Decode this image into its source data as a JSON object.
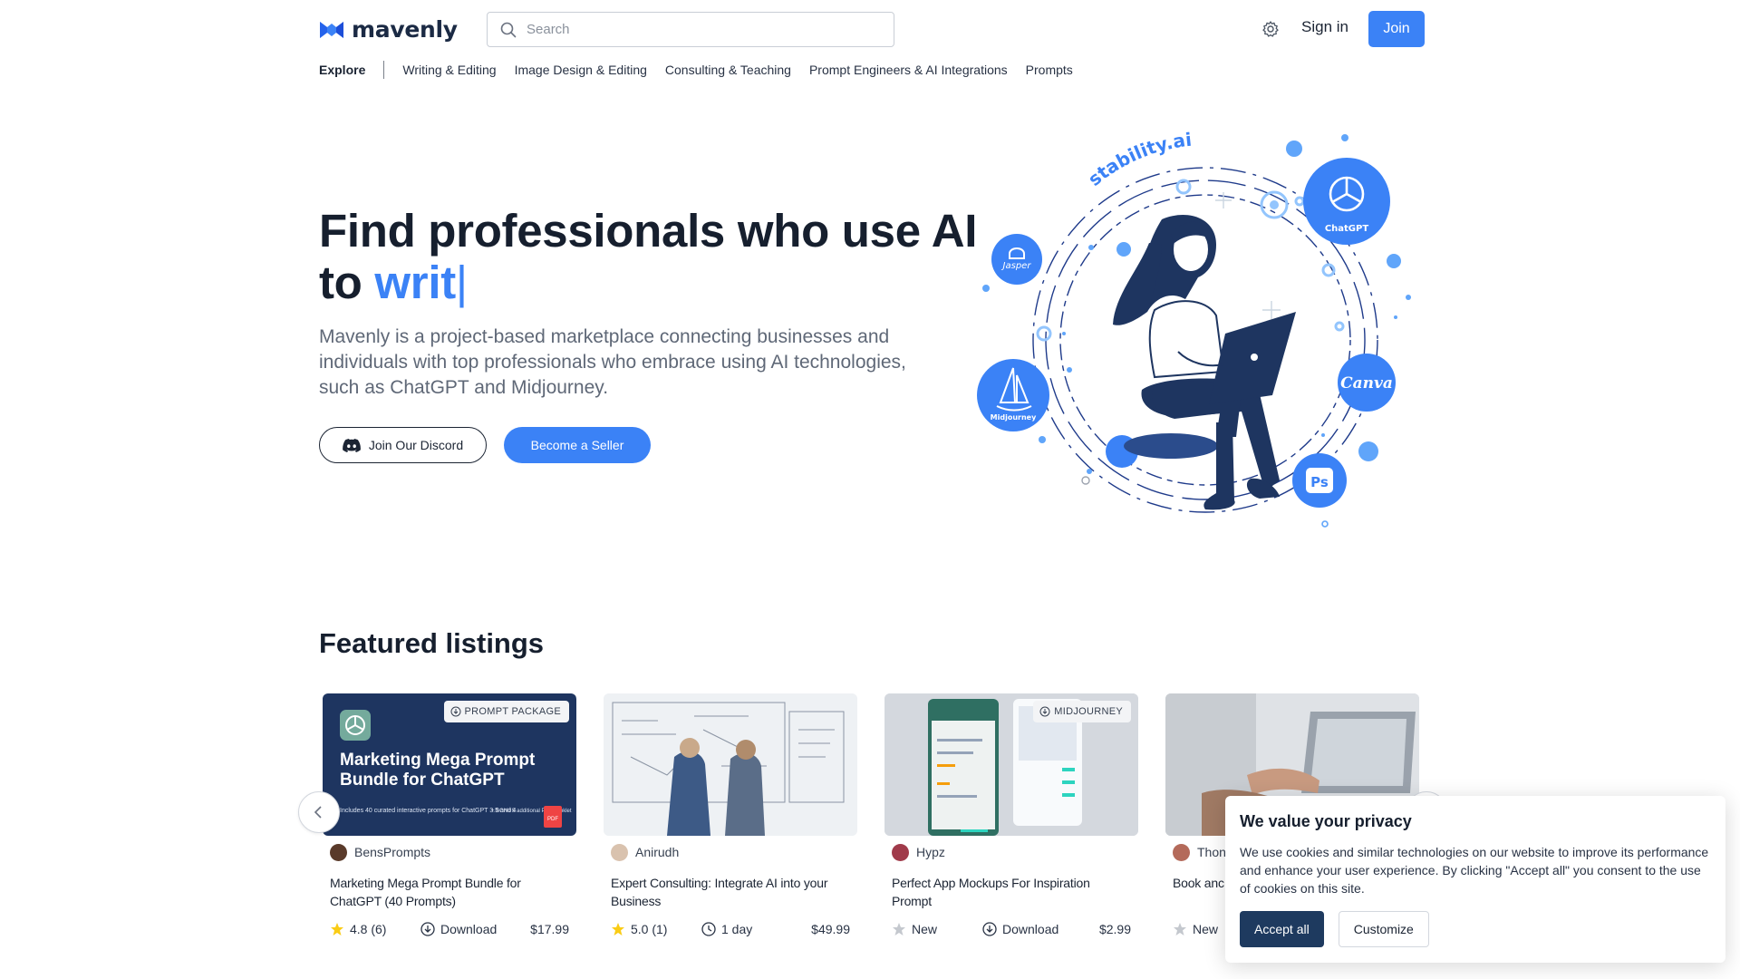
{
  "brand": {
    "name": "mavenly",
    "color": "#3b82f6",
    "dark": "#1b2a44"
  },
  "header": {
    "search_placeholder": "Search",
    "signin_label": "Sign in",
    "join_label": "Join"
  },
  "nav": {
    "explore": "Explore",
    "categories": [
      "Writing & Editing",
      "Image Design & Editing",
      "Consulting & Teaching",
      "Prompt Engineers & AI Integrations",
      "Prompts"
    ]
  },
  "hero": {
    "title_line1": "Find professionals who use AI",
    "title_prefix": "to",
    "title_typed": "writ",
    "title_caret": "|",
    "description": "Mavenly is a project-based marketplace connecting businesses and individuals with top professionals who embrace using AI technologies, such as ChatGPT and Midjourney.",
    "discord_label": "Join Our Discord",
    "seller_label": "Become a Seller",
    "art_labels": {
      "stability": "stability.ai",
      "chatgpt": "ChatGPT",
      "jasper": "Jasper",
      "canva": "Canva",
      "midjourney": "Midjourney",
      "photoshop": "Ps"
    }
  },
  "featured": {
    "title": "Featured listings",
    "cards": [
      {
        "badge": "PROMPT PACKAGE",
        "thumb_title": "Marketing Mega Prompt Bundle for ChatGPT",
        "thumb_sub": "Includes 40 curated interactive prompts for ChatGPT 3.5 and 4",
        "thumb_bonus": "+ BONUS additional PDF booklet",
        "thumb_pdf": "PDF",
        "seller": "BensPrompts",
        "title": "Marketing Mega Prompt Bundle for ChatGPT (40 Prompts)",
        "rating": "4.8 (6)",
        "delivery": "Download",
        "price": "$17.99"
      },
      {
        "badge": "",
        "seller": "Anirudh",
        "title": "Expert Consulting: Integrate AI into your Business",
        "rating": "5.0 (1)",
        "delivery": "1 day",
        "price": "$49.99"
      },
      {
        "badge": "MIDJOURNEY",
        "seller": "Hypz",
        "title": "Perfect App Mockups For Inspiration Prompt",
        "rating": "New",
        "delivery": "Download",
        "price": "$2.99"
      },
      {
        "badge": "",
        "seller": "Thon",
        "title": "Book anc",
        "rating": "New",
        "delivery": "",
        "price": ""
      }
    ]
  },
  "cookie": {
    "title": "We value your privacy",
    "text": "We use cookies and similar technologies on our website to improve its performance and enhance your user experience. By clicking \"Accept all\" you consent to the use of cookies on this site.",
    "accept_label": "Accept all",
    "customize_label": "Customize"
  }
}
